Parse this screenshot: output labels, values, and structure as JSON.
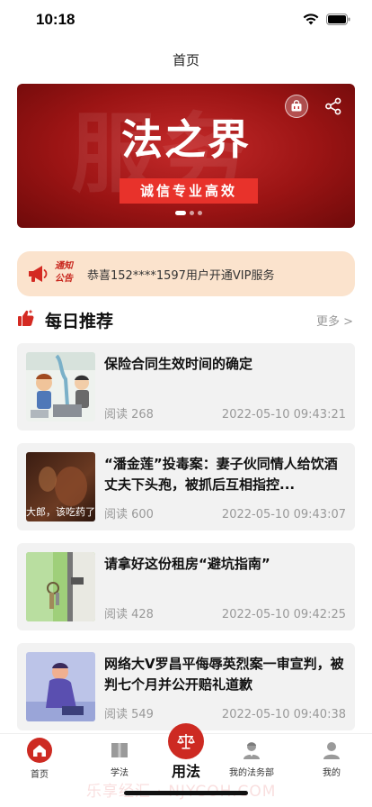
{
  "status": {
    "time": "10:18"
  },
  "nav": {
    "title": "首页"
  },
  "banner": {
    "title": "法之界",
    "slogan": "诚信专业高效",
    "bg_text": "服务",
    "dots_total": 3,
    "dots_active": 0
  },
  "notice": {
    "tag_line1": "通知",
    "tag_line2": "公告",
    "text": "恭喜152****1597用户开通VIP服务"
  },
  "section": {
    "title": "每日推荐",
    "more": "更多 >"
  },
  "articles": [
    {
      "title": "保险合同生效时间的确定",
      "reads": "阅读 268",
      "date": "2022-05-10 09:43:21"
    },
    {
      "title": "“潘金莲”投毒案：妻子伙同情人给饮酒丈夫下头孢，被抓后互相指控...",
      "reads": "阅读 600",
      "date": "2022-05-10 09:43:07",
      "thumb_caption": "大郎，该吃药了"
    },
    {
      "title": "请拿好这份租房“避坑指南”",
      "reads": "阅读 428",
      "date": "2022-05-10 09:42:25"
    },
    {
      "title": "网络大V罗昌平侮辱英烈案一审宣判，被判七个月并公开赔礼道歉",
      "reads": "阅读 549",
      "date": "2022-05-10 09:40:38"
    }
  ],
  "tabs": [
    {
      "label": "首页",
      "icon": "home-icon",
      "active": true
    },
    {
      "label": "学法",
      "icon": "book-icon"
    },
    {
      "label": "用法",
      "icon": "scales-icon"
    },
    {
      "label": "我的法务部",
      "icon": "lawyer-icon"
    },
    {
      "label": "我的",
      "icon": "person-icon"
    }
  ],
  "watermark": "乐享经汇 · NJYCOH.COM",
  "colors": {
    "brand": "#cd2a22",
    "notice_bg": "#fbe3cd",
    "card_bg": "#f2f2f2"
  }
}
